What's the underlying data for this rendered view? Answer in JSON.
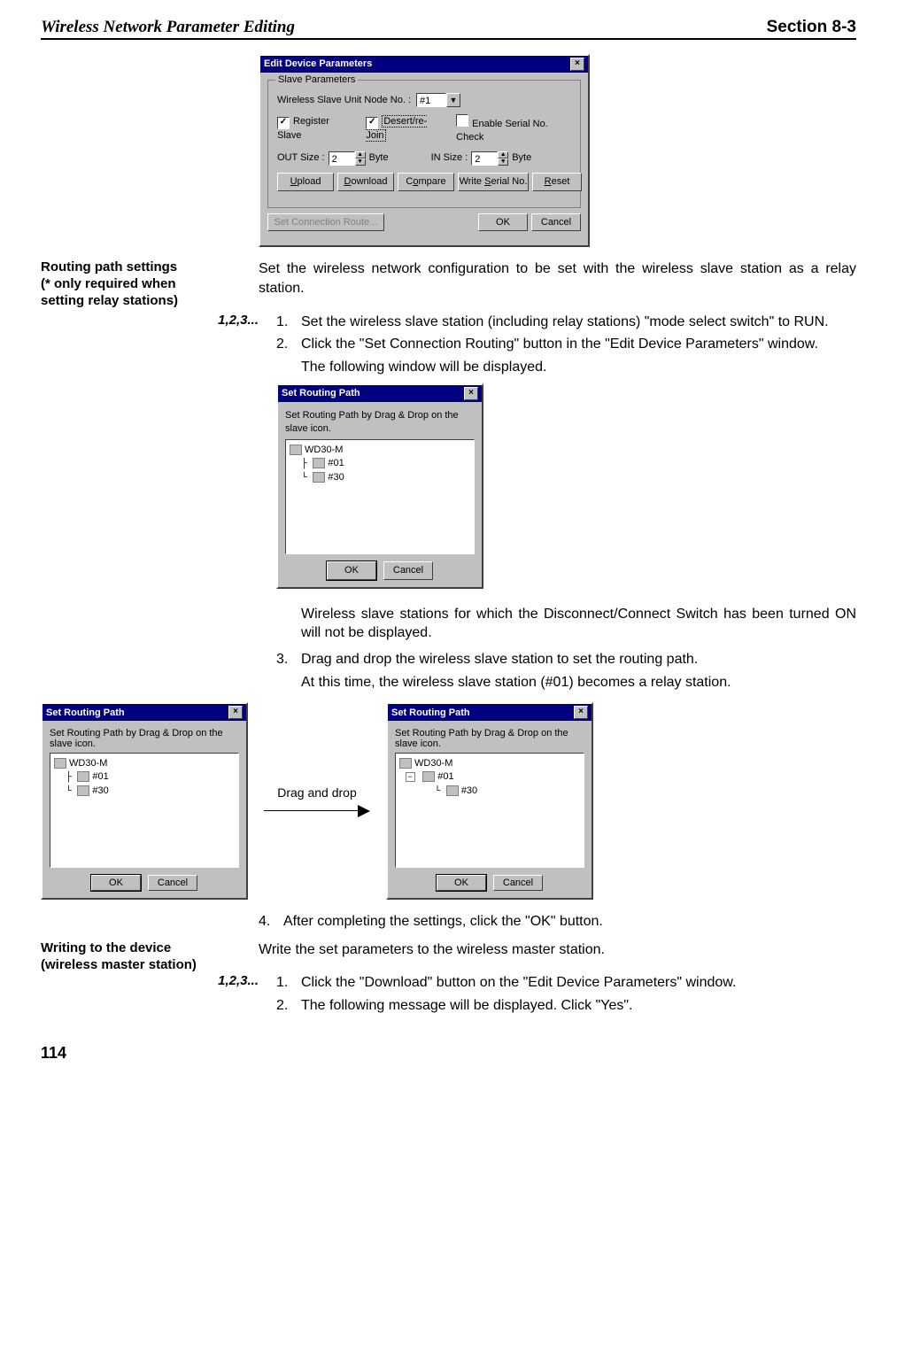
{
  "header": {
    "left": "Wireless Network Parameter Editing",
    "right": "Section 8-3"
  },
  "dlg_edit": {
    "title": "Edit Device Parameters",
    "group_title": "Slave Parameters",
    "node_label": "Wireless Slave Unit Node No. :",
    "node_value": "#1",
    "register_slave": "Register Slave",
    "desert_rejoin": "Desert/re-Join",
    "enable_serial": "Enable Serial No. Check",
    "out_label": "OUT Size :",
    "out_value": "2",
    "in_label": "IN Size :",
    "in_value": "2",
    "byte": "Byte",
    "btn_upload": "Upload",
    "btn_download": "Download",
    "btn_compare": "Compare",
    "btn_writeserial": "Write Serial No.",
    "btn_reset": "Reset",
    "btn_route": "Set Connection Route...",
    "btn_ok": "OK",
    "btn_cancel": "Cancel"
  },
  "section_routing": {
    "heading_l1": "Routing path settings",
    "heading_l2": "(* only required when",
    "heading_l3": "setting relay stations)",
    "intro": "Set the wireless network configuration to be set with the wireless slave station as a relay station.",
    "steps_label": "1,2,3...",
    "step1": "Set the wireless slave station (including relay stations) \"mode select switch\" to RUN.",
    "step2": "Click the \"Set Connection Routing\" button in the \"Edit Device Parameters\" window.",
    "step2b": "The following window will be displayed.",
    "note_after_tree": "Wireless slave stations for which the Disconnect/Connect Switch has been turned ON will not be displayed.",
    "step3": "Drag and drop the wireless slave station to set the routing path.",
    "step3b": "At this time, the wireless slave station (#01) becomes a relay station.",
    "drag_label": "Drag and drop",
    "step4": "After completing the settings, click the \"OK\" button."
  },
  "dlg_route": {
    "title": "Set Routing Path",
    "hint": "Set Routing Path by Drag & Drop on the slave icon.",
    "tree_root": "WD30-M",
    "tree_n1": "#01",
    "tree_n2": "#30",
    "btn_ok": "OK",
    "btn_cancel": "Cancel"
  },
  "section_write": {
    "heading_l1": "Writing to the device",
    "heading_l2": "(wireless master station)",
    "intro": "Write the set parameters to the wireless master station.",
    "steps_label": "1,2,3...",
    "step1": "Click the \"Download\" button on the \"Edit Device Parameters\" window.",
    "step2": "The following message will be displayed. Click \"Yes\"."
  },
  "page_number": "114",
  "ui_text": {
    "tri_down": "▼",
    "tri_up": "▲",
    "check": "✓",
    "x": "×",
    "minus": "−"
  }
}
